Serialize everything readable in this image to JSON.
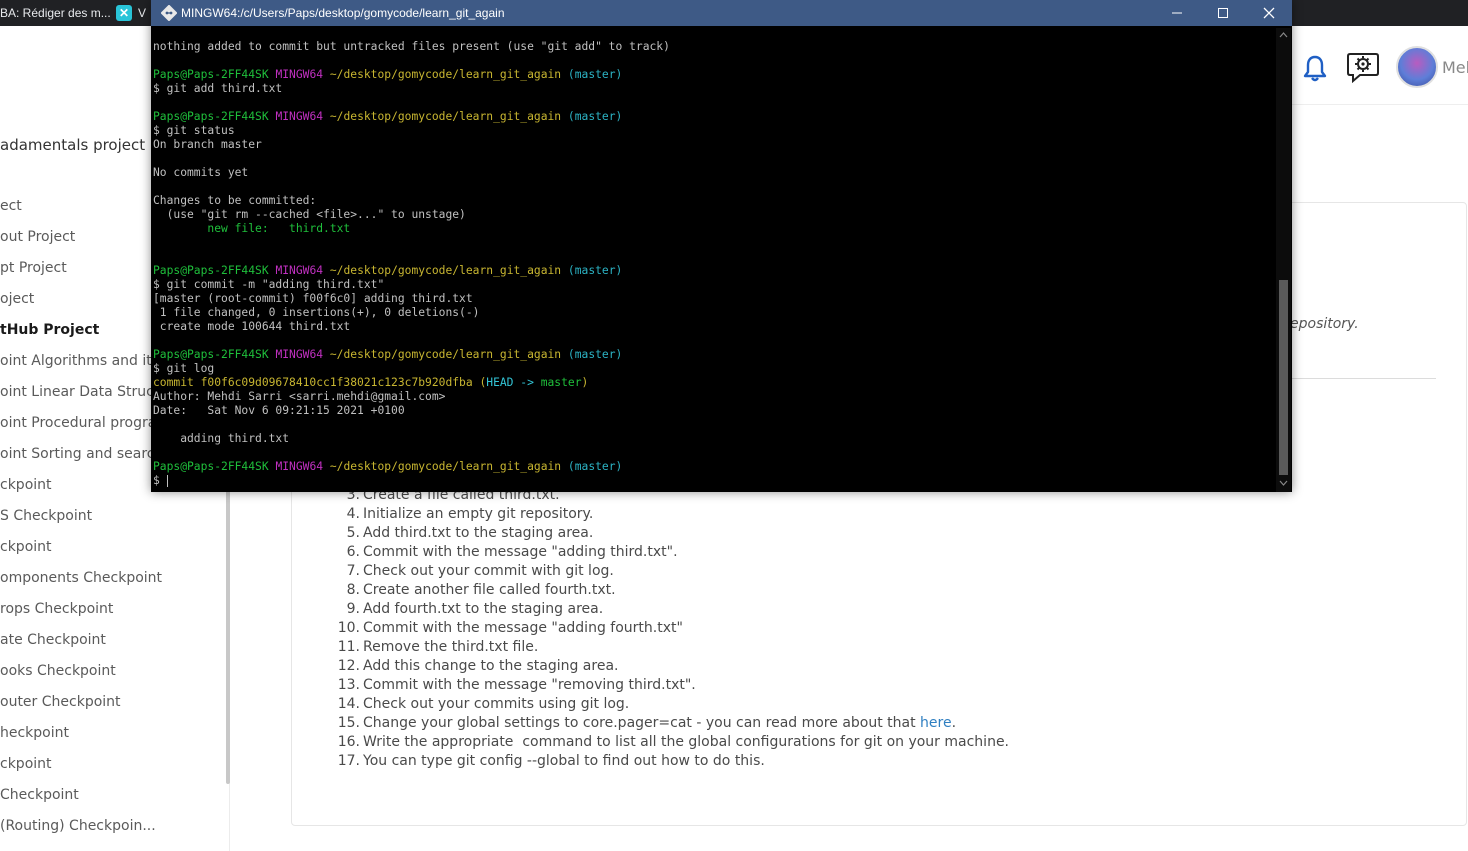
{
  "browser": {
    "tabs": [
      {
        "label": "BA: Rédiger des m..."
      },
      {
        "label": "V"
      }
    ]
  },
  "header": {
    "user_name": "Mel"
  },
  "sidebar": {
    "title": "adamentals project",
    "items": [
      {
        "label": "ect",
        "bold": false
      },
      {
        "label": "out Project",
        "bold": false
      },
      {
        "label": "pt Project",
        "bold": false
      },
      {
        "label": "oject",
        "bold": false
      },
      {
        "label": "tHub Project",
        "bold": true
      },
      {
        "label": "oint Algorithms and it",
        "bold": false
      },
      {
        "label": "oint Linear Data Struc",
        "bold": false
      },
      {
        "label": "oint Procedural progra",
        "bold": false
      },
      {
        "label": "oint Sorting and searc",
        "bold": false
      },
      {
        "label": "ckpoint",
        "bold": false
      },
      {
        "label": "S Checkpoint",
        "bold": false
      },
      {
        "label": "ckpoint",
        "bold": false
      },
      {
        "label": "omponents Checkpoint",
        "bold": false
      },
      {
        "label": "rops Checkpoint",
        "bold": false
      },
      {
        "label": "ate Checkpoint",
        "bold": false
      },
      {
        "label": "ooks Checkpoint",
        "bold": false
      },
      {
        "label": "outer Checkpoint",
        "bold": false
      },
      {
        "label": "heckpoint",
        "bold": false
      },
      {
        "label": "ckpoint",
        "bold": false
      },
      {
        "label": "Checkpoint",
        "bold": false
      },
      {
        "label": "(Routing) Checkpoin...",
        "bold": false
      }
    ]
  },
  "main": {
    "description_fragment": "epository.",
    "instructions": [
      {
        "num": "3.",
        "text": "Create a file called third.txt."
      },
      {
        "num": "4.",
        "text": "Initialize an empty git repository."
      },
      {
        "num": "5.",
        "text": "Add third.txt to the staging area."
      },
      {
        "num": "6.",
        "text": "Commit with the message \"adding third.txt\"."
      },
      {
        "num": "7.",
        "text": "Check out your commit with git log."
      },
      {
        "num": "8.",
        "text": "Create another file called fourth.txt."
      },
      {
        "num": "9.",
        "text": "Add fourth.txt to the staging area."
      },
      {
        "num": "10.",
        "text": "Commit with the message \"adding fourth.txt\""
      },
      {
        "num": "11.",
        "text": "Remove the third.txt file."
      },
      {
        "num": "12.",
        "text": "Add this change to the staging area."
      },
      {
        "num": "13.",
        "text": "Commit with the message \"removing third.txt\"."
      },
      {
        "num": "14.",
        "text": "Check out your commits using git log."
      },
      {
        "num": "15.",
        "text": "Change your global settings to core.pager=cat - you can read more about that ",
        "link": "here",
        "suffix": "."
      },
      {
        "num": "16.",
        "text": "Write the appropriate  command to list all the global configurations for git on your machine."
      },
      {
        "num": "17.",
        "text": "You can type git config --global to find out how to do this."
      }
    ]
  },
  "terminal": {
    "title": "MINGW64:/c/Users/Paps/desktop/gomycode/learn_git_again",
    "lines": [
      [
        {
          "t": "nothing added to commit but untracked files present (use \"git add\" to track)"
        }
      ],
      [],
      [
        {
          "t": "Paps@Paps-2FF44SK",
          "c": "g"
        },
        {
          "t": " "
        },
        {
          "t": "MINGW64",
          "c": "m"
        },
        {
          "t": " "
        },
        {
          "t": "~/desktop/gomycode/learn_git_again",
          "c": "y"
        },
        {
          "t": " "
        },
        {
          "t": "(master)",
          "c": "c"
        }
      ],
      [
        {
          "t": "$ git add third.txt"
        }
      ],
      [],
      [
        {
          "t": "Paps@Paps-2FF44SK",
          "c": "g"
        },
        {
          "t": " "
        },
        {
          "t": "MINGW64",
          "c": "m"
        },
        {
          "t": " "
        },
        {
          "t": "~/desktop/gomycode/learn_git_again",
          "c": "y"
        },
        {
          "t": " "
        },
        {
          "t": "(master)",
          "c": "c"
        }
      ],
      [
        {
          "t": "$ git status"
        }
      ],
      [
        {
          "t": "On branch master"
        }
      ],
      [],
      [
        {
          "t": "No commits yet"
        }
      ],
      [],
      [
        {
          "t": "Changes to be committed:"
        }
      ],
      [
        {
          "t": "  (use \"git rm --cached <file>...\" to unstage)"
        }
      ],
      [
        {
          "t": "        new file:   third.txt",
          "c": "g"
        }
      ],
      [],
      [],
      [
        {
          "t": "Paps@Paps-2FF44SK",
          "c": "g"
        },
        {
          "t": " "
        },
        {
          "t": "MINGW64",
          "c": "m"
        },
        {
          "t": " "
        },
        {
          "t": "~/desktop/gomycode/learn_git_again",
          "c": "y"
        },
        {
          "t": " "
        },
        {
          "t": "(master)",
          "c": "c"
        }
      ],
      [
        {
          "t": "$ git commit -m \"adding third.txt\""
        }
      ],
      [
        {
          "t": "[master (root-commit) f00f6c0] adding third.txt"
        }
      ],
      [
        {
          "t": " 1 file changed, 0 insertions(+), 0 deletions(-)"
        }
      ],
      [
        {
          "t": " create mode 100644 third.txt"
        }
      ],
      [],
      [
        {
          "t": "Paps@Paps-2FF44SK",
          "c": "g"
        },
        {
          "t": " "
        },
        {
          "t": "MINGW64",
          "c": "m"
        },
        {
          "t": " "
        },
        {
          "t": "~/desktop/gomycode/learn_git_again",
          "c": "y"
        },
        {
          "t": " "
        },
        {
          "t": "(master)",
          "c": "c"
        }
      ],
      [
        {
          "t": "$ git log"
        }
      ],
      [
        {
          "t": "commit f00f6c09d09678410cc1f38021c123c7b920dfba",
          "c": "y"
        },
        {
          "t": " (",
          "c": "y"
        },
        {
          "t": "HEAD -> ",
          "c": "cy"
        },
        {
          "t": "master",
          "c": "g"
        },
        {
          "t": ")",
          "c": "y"
        }
      ],
      [
        {
          "t": "Author: Mehdi Sarri <sarri.mehdi@gmail.com>"
        }
      ],
      [
        {
          "t": "Date:   Sat Nov 6 09:21:15 2021 +0100"
        }
      ],
      [],
      [
        {
          "t": "    adding third.txt"
        }
      ],
      [],
      [
        {
          "t": "Paps@Paps-2FF44SK",
          "c": "g"
        },
        {
          "t": " "
        },
        {
          "t": "MINGW64",
          "c": "m"
        },
        {
          "t": " "
        },
        {
          "t": "~/desktop/gomycode/learn_git_again",
          "c": "y"
        },
        {
          "t": " "
        },
        {
          "t": "(master)",
          "c": "c"
        }
      ],
      [
        {
          "t": "$ "
        }
      ]
    ]
  },
  "colors": {
    "terminal_bg": "#000000",
    "terminal_titlebar": "#3e5a86",
    "prompt_user": "#1fbf3b",
    "prompt_host": "#c030c0",
    "prompt_path": "#c8b631",
    "prompt_branch": "#2cb3c4",
    "bell": "#1f5fc4",
    "link": "#2f7fc1"
  },
  "icons": {
    "tab2": "x-logo-icon",
    "terminal": "git-bash-icon",
    "notifications": "bell-icon",
    "support": "chat-gear-icon"
  }
}
